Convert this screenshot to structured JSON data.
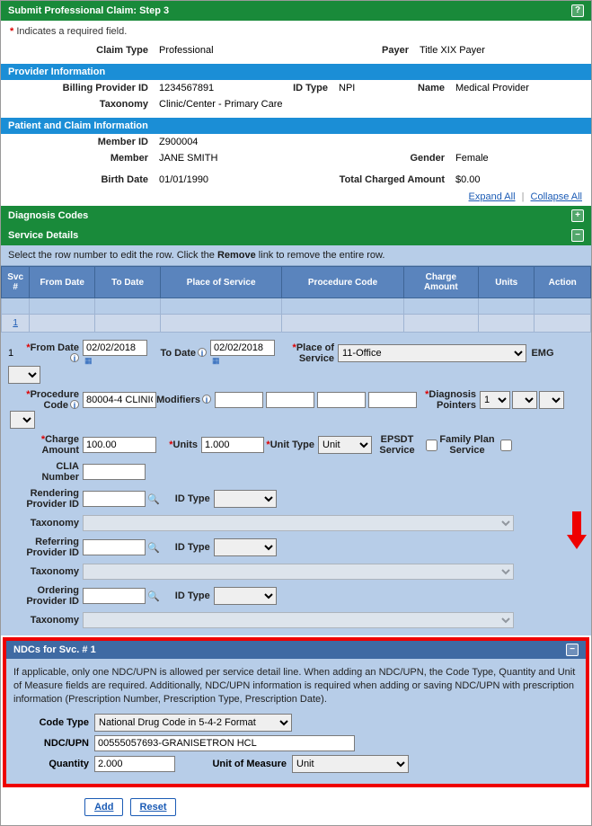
{
  "header": {
    "title": "Submit Professional Claim: Step 3"
  },
  "required_note": "Indicates a required field.",
  "claim": {
    "claim_type_label": "Claim Type",
    "claim_type": "Professional",
    "payer_label": "Payer",
    "payer": "Title XIX Payer"
  },
  "provider_section": {
    "title": "Provider Information",
    "billing_id_label": "Billing Provider ID",
    "billing_id": "1234567891",
    "id_type_label": "ID Type",
    "id_type": "NPI",
    "name_label": "Name",
    "name": "Medical Provider",
    "taxonomy_label": "Taxonomy",
    "taxonomy": "Clinic/Center - Primary Care"
  },
  "patient_section": {
    "title": "Patient and Claim Information",
    "member_id_label": "Member ID",
    "member_id": "Z900004",
    "member_label": "Member",
    "member": "JANE SMITH",
    "gender_label": "Gender",
    "gender": "Female",
    "birth_label": "Birth Date",
    "birth": "01/01/1990",
    "total_label": "Total Charged Amount",
    "total": "$0.00"
  },
  "expand": {
    "expand": "Expand All",
    "collapse": "Collapse All"
  },
  "diag_section": {
    "title": "Diagnosis Codes"
  },
  "svc_section": {
    "title": "Service Details",
    "instr_pre": "Select the row number to edit the row. Click the ",
    "instr_bold": "Remove",
    "instr_post": " link to remove the entire row.",
    "cols": {
      "svc": "Svc #",
      "from": "From Date",
      "to": "To Date",
      "place": "Place of Service",
      "proc": "Procedure Code",
      "charge": "Charge Amount",
      "units": "Units",
      "action": "Action"
    },
    "row1": {
      "num": "1"
    }
  },
  "detail": {
    "row_num": "1",
    "from_label": "From Date",
    "from_date": "02/02/2018",
    "to_label": "To Date",
    "to_date": "02/02/2018",
    "place_label": "Place of Service",
    "place": "11-Office",
    "emg_label": "EMG",
    "proc_label": "Procedure Code",
    "proc": "80004-4 CLINIC",
    "mod_label": "Modifiers",
    "diagptr_label": "Diagnosis Pointers",
    "diagptr1": "1",
    "charge_label": "Charge Amount",
    "charge": "100.00",
    "units_label": "Units",
    "units": "1.000",
    "unittype_label": "Unit Type",
    "unittype": "Unit",
    "epsdt_label": "EPSDT Service",
    "family_label": "Family Plan Service",
    "clia_label": "CLIA Number",
    "render_label": "Rendering Provider ID",
    "idtype_label": "ID Type",
    "taxonomy_label": "Taxonomy",
    "refer_label": "Referring Provider ID",
    "order_label": "Ordering Provider ID"
  },
  "ndc": {
    "title": "NDCs for Svc. # 1",
    "text": "If applicable, only one NDC/UPN is allowed per service detail line. When adding an NDC/UPN, the Code Type, Quantity and Unit of Measure fields are required. Additionally, NDC/UPN information is required when adding or saving NDC/UPN with prescription information (Prescription Number, Prescription Type, Prescription Date).",
    "codetype_label": "Code Type",
    "codetype": "National Drug Code in 5-4-2 Format",
    "upn_label": "NDC/UPN",
    "upn": "00555057693-GRANISETRON HCL",
    "qty_label": "Quantity",
    "qty": "2.000",
    "uom_label": "Unit of Measure",
    "uom": "Unit"
  },
  "buttons": {
    "add": "Add",
    "reset": "Reset"
  }
}
